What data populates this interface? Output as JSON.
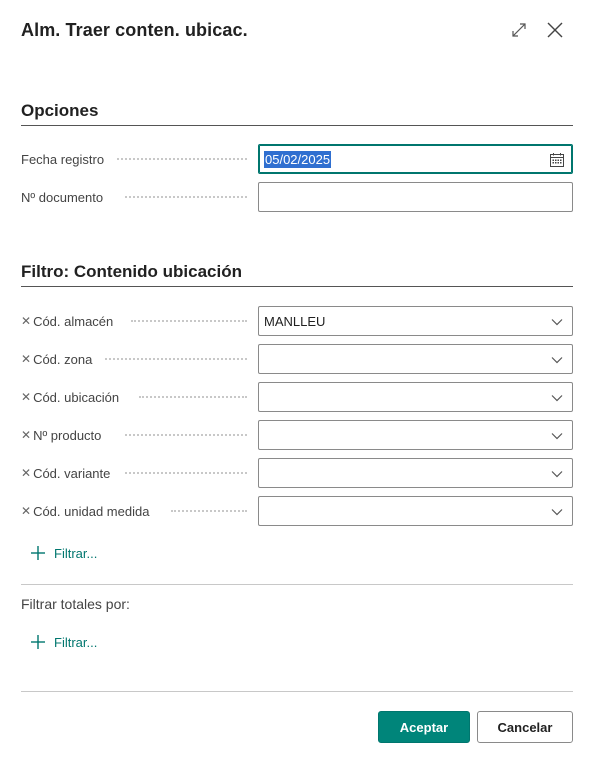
{
  "dialog": {
    "title": "Alm. Traer conten. ubicac.",
    "expand_icon": "expand-icon",
    "close_icon": "close-icon"
  },
  "options": {
    "section_title": "Opciones",
    "posting_date": {
      "label": "Fecha registro",
      "value": "05/02/2025",
      "icon": "calendar-icon"
    },
    "document_no": {
      "label": "Nº documento",
      "value": ""
    }
  },
  "filter": {
    "section_title": "Filtro: Contenido ubicación",
    "fields": [
      {
        "label": "Cód. almacén",
        "value": "MANLLEU"
      },
      {
        "label": "Cód. zona",
        "value": ""
      },
      {
        "label": "Cód. ubicación",
        "value": ""
      },
      {
        "label": "Nº producto",
        "value": ""
      },
      {
        "label": "Cód. variante",
        "value": ""
      },
      {
        "label": "Cód. unidad medida",
        "value": ""
      }
    ],
    "add_filter_label": "Filtrar..."
  },
  "totals": {
    "title": "Filtrar totales por:",
    "add_filter_label": "Filtrar..."
  },
  "actions": {
    "ok_label": "Aceptar",
    "cancel_label": "Cancelar"
  },
  "colors": {
    "accent": "#00857a",
    "selection": "#2f6fd0"
  }
}
